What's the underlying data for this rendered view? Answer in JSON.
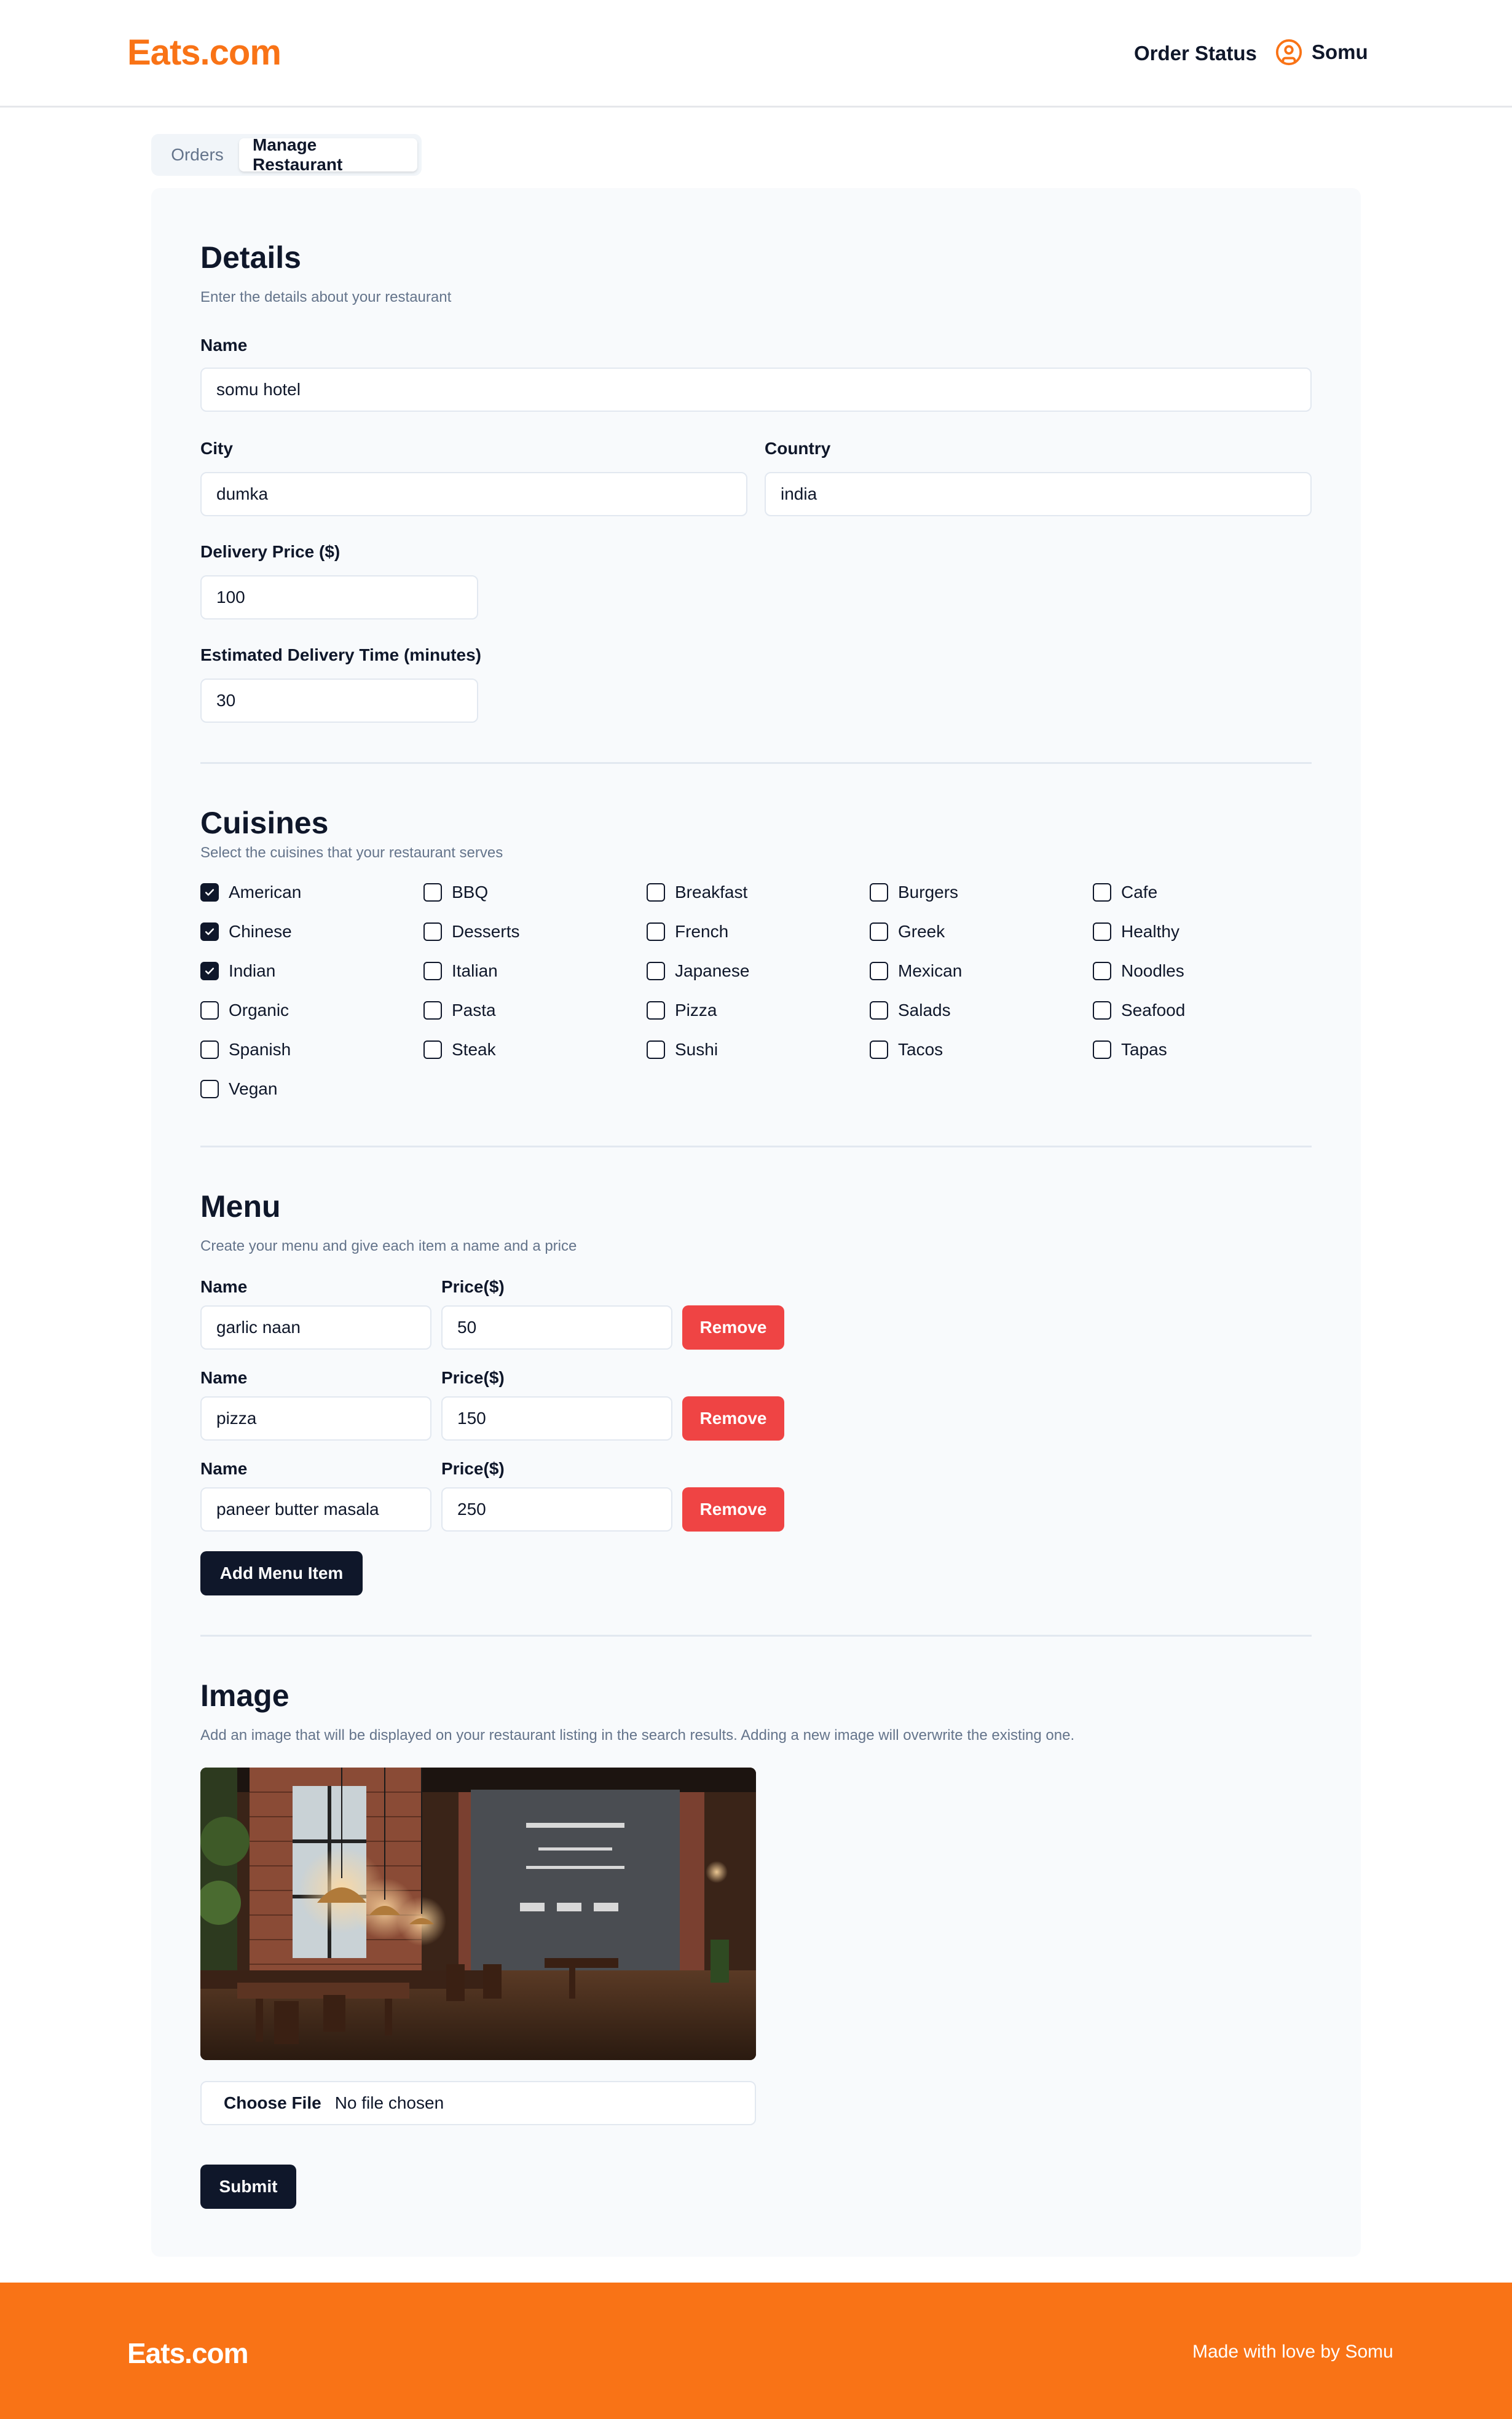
{
  "header": {
    "logo": "Eats.com",
    "order_status": "Order Status",
    "username": "Somu"
  },
  "tabs": [
    {
      "label": "Orders",
      "active": false
    },
    {
      "label": "Manage Restaurant",
      "active": true
    }
  ],
  "details": {
    "title": "Details",
    "subtitle": "Enter the details about your restaurant",
    "name_label": "Name",
    "name_value": "somu hotel",
    "city_label": "City",
    "city_value": "dumka",
    "country_label": "Country",
    "country_value": "india",
    "delivery_price_label": "Delivery Price ($)",
    "delivery_price_value": "100",
    "delivery_time_label": "Estimated Delivery Time (minutes)",
    "delivery_time_value": "30"
  },
  "cuisines": {
    "title": "Cuisines",
    "subtitle": "Select the cuisines that your restaurant serves",
    "items": [
      {
        "label": "American",
        "checked": true
      },
      {
        "label": "BBQ",
        "checked": false
      },
      {
        "label": "Breakfast",
        "checked": false
      },
      {
        "label": "Burgers",
        "checked": false
      },
      {
        "label": "Cafe",
        "checked": false
      },
      {
        "label": "Chinese",
        "checked": true
      },
      {
        "label": "Desserts",
        "checked": false
      },
      {
        "label": "French",
        "checked": false
      },
      {
        "label": "Greek",
        "checked": false
      },
      {
        "label": "Healthy",
        "checked": false
      },
      {
        "label": "Indian",
        "checked": true
      },
      {
        "label": "Italian",
        "checked": false
      },
      {
        "label": "Japanese",
        "checked": false
      },
      {
        "label": "Mexican",
        "checked": false
      },
      {
        "label": "Noodles",
        "checked": false
      },
      {
        "label": "Organic",
        "checked": false
      },
      {
        "label": "Pasta",
        "checked": false
      },
      {
        "label": "Pizza",
        "checked": false
      },
      {
        "label": "Salads",
        "checked": false
      },
      {
        "label": "Seafood",
        "checked": false
      },
      {
        "label": "Spanish",
        "checked": false
      },
      {
        "label": "Steak",
        "checked": false
      },
      {
        "label": "Sushi",
        "checked": false
      },
      {
        "label": "Tacos",
        "checked": false
      },
      {
        "label": "Tapas",
        "checked": false
      },
      {
        "label": "Vegan",
        "checked": false
      }
    ]
  },
  "menu": {
    "title": "Menu",
    "subtitle": "Create your menu and give each item a name and a price",
    "name_label": "Name",
    "price_label": "Price($)",
    "remove_label": "Remove",
    "add_label": "Add Menu Item",
    "items": [
      {
        "name": "garlic naan",
        "price": "50"
      },
      {
        "name": "pizza",
        "price": "150"
      },
      {
        "name": "paneer butter masala",
        "price": "250"
      }
    ]
  },
  "image": {
    "title": "Image",
    "subtitle": "Add an image that will be displayed on your restaurant listing in the search results. Adding a new image will overwrite the existing one.",
    "choose_file_label": "Choose File",
    "file_status": "No file chosen"
  },
  "submit_label": "Submit",
  "footer": {
    "logo": "Eats.com",
    "credit": "Made with love by Somu"
  },
  "colors": {
    "brand_orange": "#f97316",
    "remove_red": "#ef4444",
    "dark_button": "#0f172a"
  }
}
